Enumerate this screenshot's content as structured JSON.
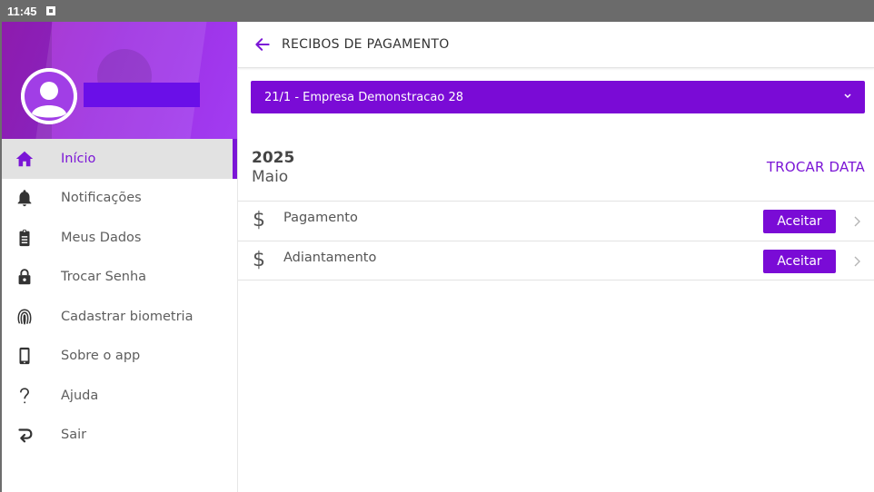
{
  "statusbar": {
    "time": "11:45",
    "notification_icon": "a-box-icon"
  },
  "drawer": {
    "user_name": "",
    "items": [
      {
        "label": "Início",
        "icon": "home-icon",
        "active": true
      },
      {
        "label": "Notificações",
        "icon": "bell-icon"
      },
      {
        "label": "Meus Dados",
        "icon": "id-badge-icon"
      },
      {
        "label": "Trocar Senha",
        "icon": "lock-icon"
      },
      {
        "label": "Cadastrar biometria",
        "icon": "fingerprint-icon"
      },
      {
        "label": "Sobre o app",
        "icon": "phone-icon"
      },
      {
        "label": "Ajuda",
        "icon": "question-icon"
      },
      {
        "label": "Sair",
        "icon": "return-arrow-icon"
      }
    ]
  },
  "appbar": {
    "title": "RECIBOS DE PAGAMENTO"
  },
  "company_select": {
    "value": "21/1 - Empresa Demonstracao 28"
  },
  "period": {
    "year": "2025",
    "month": "Maio",
    "change_label": "TROCAR DATA"
  },
  "receipts": [
    {
      "currency_symbol": "$",
      "label": "Pagamento",
      "action_label": "Aceitar"
    },
    {
      "currency_symbol": "$",
      "label": "Adiantamento",
      "action_label": "Aceitar"
    }
  ],
  "colors": {
    "accent": "#7a0bd6",
    "statusbar": "#6b6b6b"
  }
}
